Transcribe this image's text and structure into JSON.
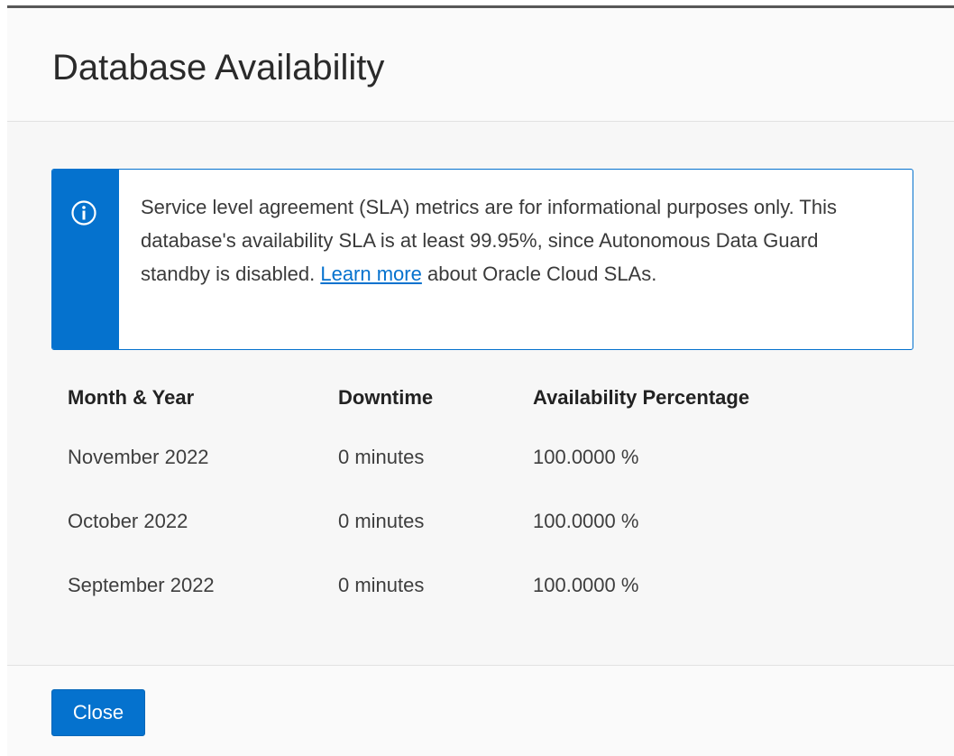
{
  "dialog": {
    "title": "Database Availability"
  },
  "info_banner": {
    "icon": "info-circle-icon",
    "accent_color": "#0572ce",
    "text_before_link": "Service level agreement (SLA) metrics are for informational purposes only. This database's availability SLA is at least 99.95%, since Autonomous Data Guard standby is disabled. ",
    "link_text": "Learn more",
    "text_after_link": " about Oracle Cloud SLAs."
  },
  "table": {
    "columns": [
      "Month & Year",
      "Downtime",
      "Availability Percentage"
    ],
    "rows": [
      {
        "month": "November 2022",
        "downtime": "0 minutes",
        "availability": "100.0000 %"
      },
      {
        "month": "October 2022",
        "downtime": "0 minutes",
        "availability": "100.0000 %"
      },
      {
        "month": "September 2022",
        "downtime": "0 minutes",
        "availability": "100.0000 %"
      }
    ]
  },
  "footer": {
    "close_label": "Close",
    "button_color": "#0572ce"
  }
}
